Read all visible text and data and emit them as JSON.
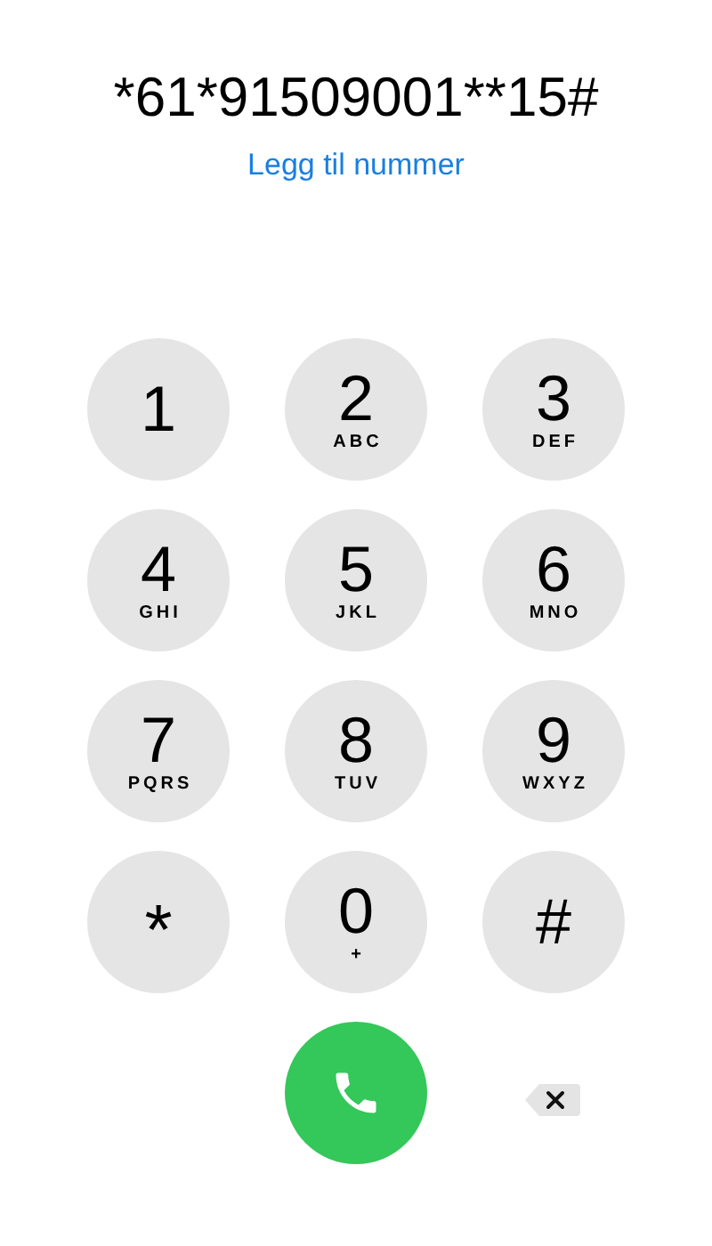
{
  "number": "*61*91509001**15#",
  "add_number_link": "Legg til nummer",
  "keys": [
    {
      "digit": "1"
    },
    {
      "digit": "2",
      "letters": "ABC"
    },
    {
      "digit": "3",
      "letters": "DEF"
    },
    {
      "digit": "4",
      "letters": "GHI"
    },
    {
      "digit": "5",
      "letters": "JKL"
    },
    {
      "digit": "6",
      "letters": "MNO"
    },
    {
      "digit": "7",
      "letters": "PQRS"
    },
    {
      "digit": "8",
      "letters": "TUV"
    },
    {
      "digit": "9",
      "letters": "WXYZ"
    },
    {
      "digit": "*"
    },
    {
      "digit": "0",
      "letters": "+"
    },
    {
      "digit": "#"
    }
  ]
}
